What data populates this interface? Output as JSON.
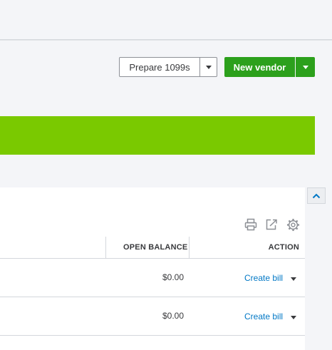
{
  "toolbar": {
    "prepare_1099s_label": "Prepare 1099s",
    "new_vendor_label": "New vendor"
  },
  "colors": {
    "accent_green": "#2ca01c",
    "banner_green": "#7ac900",
    "link_blue": "#0077c5"
  },
  "table": {
    "tools": [
      "printer-icon",
      "export-icon",
      "gear-icon"
    ],
    "columns": {
      "open_balance": "OPEN BALANCE",
      "action": "ACTION"
    },
    "rows": [
      {
        "open_balance": "$0.00",
        "action": "Create bill"
      },
      {
        "open_balance": "$0.00",
        "action": "Create bill"
      }
    ]
  }
}
